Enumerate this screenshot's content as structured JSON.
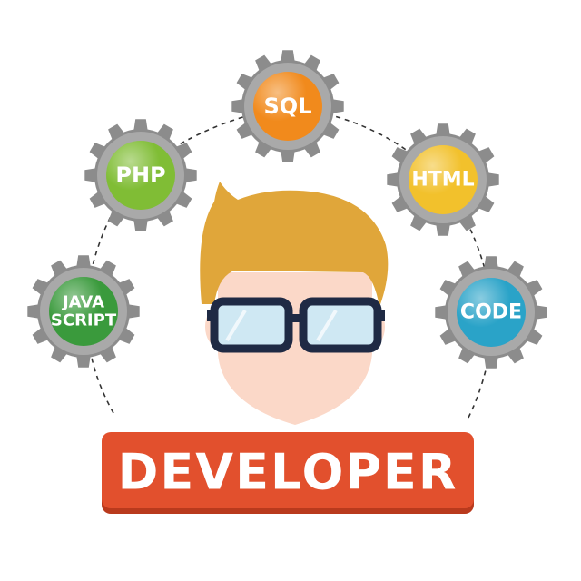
{
  "banner": {
    "label": "DEVELOPER",
    "color": "#e2502d"
  },
  "gears": [
    {
      "label_lines": [
        "SQL"
      ],
      "color": "#f18a1c",
      "icon": "gear-icon"
    },
    {
      "label_lines": [
        "PHP"
      ],
      "color": "#80bd35",
      "icon": "gear-icon"
    },
    {
      "label_lines": [
        "HTML"
      ],
      "color": "#f2c12c",
      "icon": "gear-icon"
    },
    {
      "label_lines": [
        "JAVA",
        "SCRIPT"
      ],
      "color": "#3a9a3c",
      "icon": "gear-icon"
    },
    {
      "label_lines": [
        "CODE"
      ],
      "color": "#2aa3c8",
      "icon": "gear-icon"
    }
  ],
  "character": {
    "hair_color": "#e0a63a",
    "skin_color": "#fbd8c8",
    "glasses_color": "#1f2a44",
    "lens_color": "#cfe8f3"
  },
  "colors": {
    "gear": "#8c8c8c",
    "gear_inner": "#a9a9a9"
  }
}
